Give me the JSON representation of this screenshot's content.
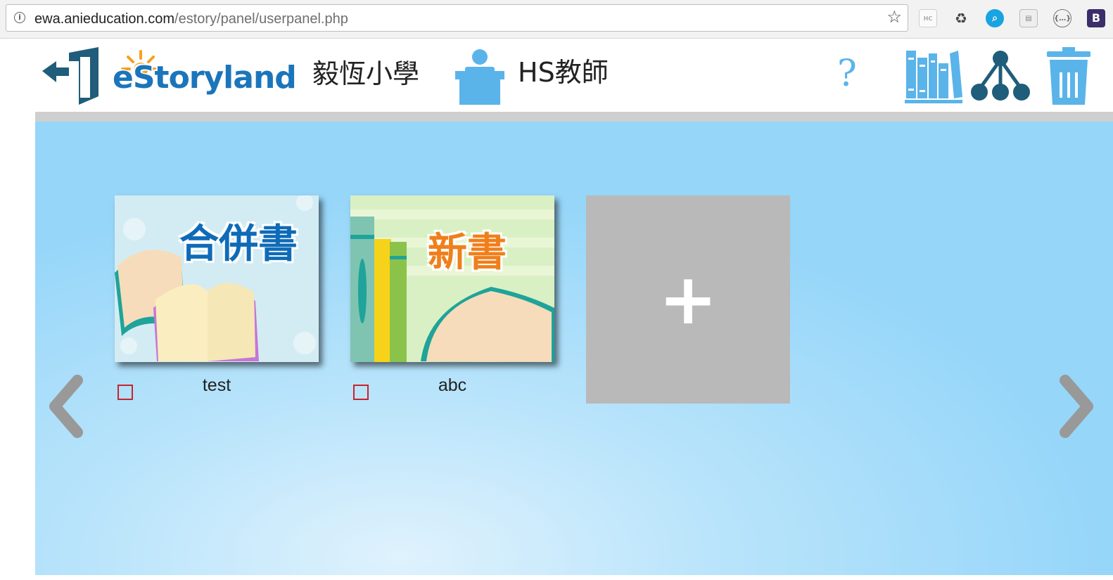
{
  "browser": {
    "url_host": "ewa.anieducation.com",
    "url_path": "/estory/panel/userpanel.php",
    "info_icon": "info-icon",
    "star_icon": "star-icon",
    "extensions": [
      "tab-icon",
      "recycle-icon",
      "search-icon",
      "page-icon",
      "code-icon",
      "b-icon"
    ],
    "b_icon_label": "B"
  },
  "header": {
    "logo_text": "eStoryland",
    "school_name": "毅恆小學",
    "teacher_label": "HS教師",
    "help_label": "?",
    "accent_color": "#5ab4ea",
    "dark_color": "#1f5d7a"
  },
  "books": [
    {
      "cover_text": "合併書",
      "label": "test",
      "cover_color": "#d3ecf3",
      "title_color": "#0e6bb8"
    },
    {
      "cover_text": "新書",
      "label": "abc",
      "cover_color": "#d9f0c4",
      "title_color": "#f07f1b"
    }
  ],
  "add_tile": {
    "label": "+"
  }
}
